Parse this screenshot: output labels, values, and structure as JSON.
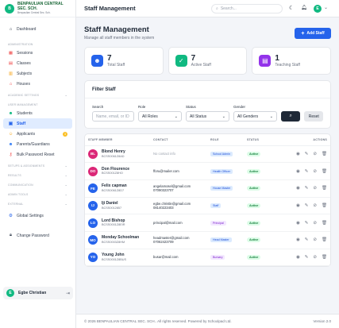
{
  "brand": {
    "name_line1": "BENPAULIAN CENTRAL",
    "name_line2": "SEC. SCH.",
    "tagline": "Benpaulian Central Sec. Sch.",
    "logo_letter": "B"
  },
  "sidebar": {
    "dashboard": "Dashboard",
    "section_admin": "ADMINISTRATION",
    "sessions": "Sessions",
    "classes": "Classes",
    "subjects": "Subjects",
    "houses": "Houses",
    "section_academic": "ACADEMIC SETTINGS",
    "section_users": "USER MANAGEMENT",
    "students": "Students",
    "staff": "Staff",
    "applicants": "Applicants",
    "applicants_badge": "3",
    "parents": "Parents/Guardians",
    "bulk_reset": "Bulk Password Reset",
    "section_setups": "SETUPS & ASSIGNMENTS",
    "section_results": "RESULTS",
    "section_communication": "COMMUNICATION",
    "section_admin_tools": "ADMIN TOOLS",
    "section_external": "EXTERNAL",
    "global_settings": "Global Settings",
    "change_password": "Change Password",
    "user_name": "Egbe Christian",
    "user_initial": "E"
  },
  "topbar": {
    "title": "Staff Management",
    "search_placeholder": "Search...",
    "user_initial": "E"
  },
  "page": {
    "title": "Staff Management",
    "subtitle": "Manage all staff members in the system",
    "add_button": "Add Staff"
  },
  "stats": [
    {
      "value": "7",
      "label": "Total Staff",
      "color": "#2563eb"
    },
    {
      "value": "7",
      "label": "Active Staff",
      "color": "#10b981"
    },
    {
      "value": "1",
      "label": "Teaching Staff",
      "color": "#9333ea"
    }
  ],
  "filter": {
    "title": "Filter Staff",
    "search_label": "Search",
    "search_placeholder": "Name, email, or ID",
    "role_label": "Role",
    "role_value": "All Roles",
    "status_label": "Status",
    "status_value": "All Status",
    "gender_label": "Gender",
    "gender_value": "All Genders",
    "reset": "Reset"
  },
  "table": {
    "headers": {
      "member": "STAFF MEMBER",
      "contact": "CONTACT",
      "role": "ROLE",
      "status": "STATUS",
      "actions": "ACTIONS"
    },
    "rows": [
      {
        "initials": "BL",
        "color": "#db2777",
        "name": "Blond Henry",
        "id": "BCSS0061Z8AD",
        "email": "No contact info",
        "phone": "",
        "muted": true,
        "role": "School Admin",
        "role_style": "blue",
        "status": "Active"
      },
      {
        "initials": "DO",
        "color": "#db2777",
        "name": "Don Flourence",
        "id": "BCSS001Z8HO",
        "email": "fforu@mailer.com",
        "phone": "",
        "muted": false,
        "role": "Health Officer",
        "role_style": "blue",
        "status": "Active"
      },
      {
        "initials": "FE",
        "color": "#2563eb",
        "name": "Felix capman",
        "id": "BCSS0061Z8D7",
        "email": "angelamosel@gmail.com",
        "phone": "07090323707",
        "muted": false,
        "role": "House Master",
        "role_style": "blue",
        "status": "Active"
      },
      {
        "initials": "IJ",
        "color": "#2563eb",
        "name": "Iji Daniel",
        "id": "BCSS0012857",
        "email": "egbe.christle@gmail.com",
        "phone": "08140223403",
        "muted": false,
        "role": "Staff",
        "role_style": "blue",
        "status": "Active"
      },
      {
        "initials": "LO",
        "color": "#2563eb",
        "name": "Lord Bishop",
        "id": "BCSS0001Z8EIR",
        "email": "principal@mail.com",
        "phone": "",
        "muted": false,
        "role": "Principal",
        "role_style": "purple",
        "status": "Active"
      },
      {
        "initials": "MO",
        "color": "#2563eb",
        "name": "Monday Schoolman",
        "id": "BCSS0003Z8HM",
        "email": "headmaster@gmail.com",
        "phone": "07062423709",
        "muted": false,
        "role": "Head Master",
        "role_style": "blue",
        "status": "Active"
      },
      {
        "initials": "YO",
        "color": "#2563eb",
        "name": "Young John",
        "id": "BCSS0001Z8BUS",
        "email": "busar@mail.com",
        "phone": "",
        "muted": false,
        "role": "Bursary",
        "role_style": "purple",
        "status": "Active"
      }
    ]
  },
  "footer": {
    "copyright": "© 2026 BENPAULIAN CENTRAL SEC. SCH.. All rights reserved. Powered by Schoolpad Ltd.",
    "version": "Version 2.0"
  }
}
